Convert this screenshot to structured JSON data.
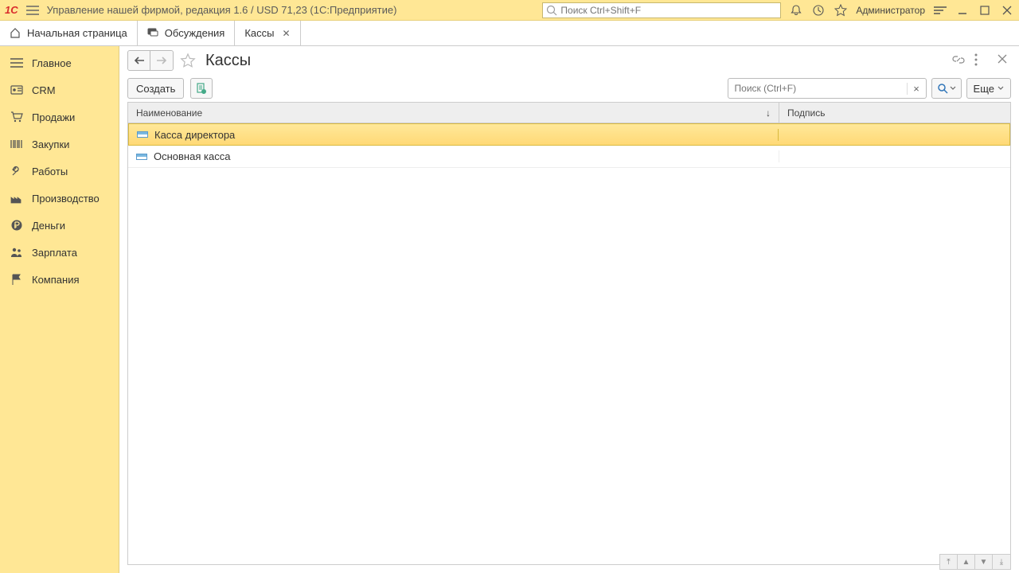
{
  "titlebar": {
    "logo": "1С",
    "title": "Управление нашей фирмой, редакция 1.6 / USD 71,23  (1С:Предприятие)",
    "search_placeholder": "Поиск Ctrl+Shift+F",
    "user": "Администратор"
  },
  "tabs": [
    {
      "label": "Начальная страница",
      "icon": "home"
    },
    {
      "label": "Обсуждения",
      "icon": "chat"
    },
    {
      "label": "Кассы",
      "icon": "none",
      "closable": true
    }
  ],
  "sidebar": {
    "items": [
      {
        "label": "Главное",
        "icon": "menu"
      },
      {
        "label": "CRM",
        "icon": "badge"
      },
      {
        "label": "Продажи",
        "icon": "cart"
      },
      {
        "label": "Закупки",
        "icon": "barcode"
      },
      {
        "label": "Работы",
        "icon": "tools"
      },
      {
        "label": "Производство",
        "icon": "factory"
      },
      {
        "label": "Деньги",
        "icon": "ruble"
      },
      {
        "label": "Зарплата",
        "icon": "people"
      },
      {
        "label": "Компания",
        "icon": "flag"
      }
    ]
  },
  "page": {
    "title": "Кассы",
    "create_label": "Создать",
    "search_placeholder": "Поиск (Ctrl+F)",
    "more_label": "Еще"
  },
  "table": {
    "columns": {
      "name": "Наименование",
      "signature": "Подпись"
    },
    "rows": [
      {
        "name": "Касса директора",
        "signature": "",
        "selected": true
      },
      {
        "name": "Основная касса",
        "signature": "",
        "selected": false
      }
    ]
  }
}
